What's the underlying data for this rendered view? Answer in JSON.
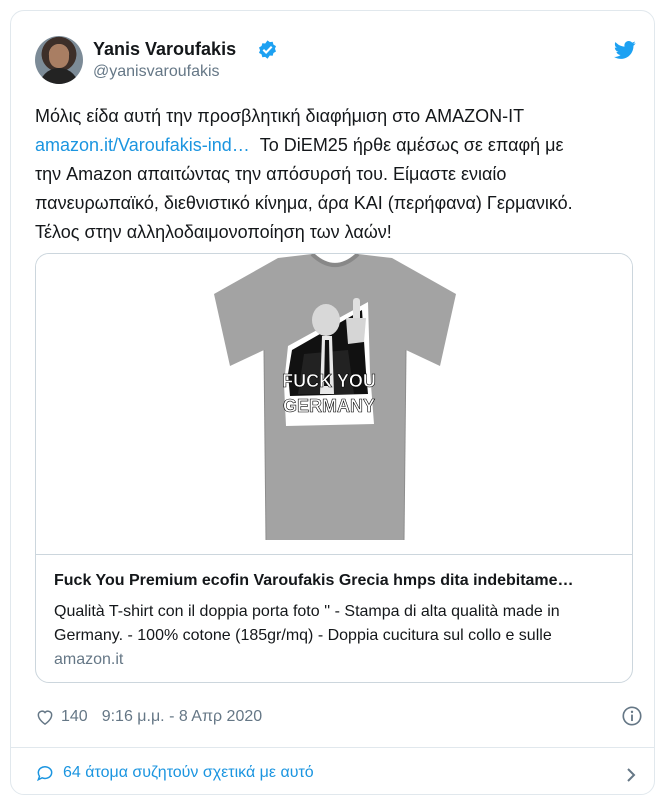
{
  "tweet": {
    "author": {
      "name": "Yanis Varoufakis",
      "handle": "@yanisvaroufakis",
      "verified": true
    },
    "text_lines": [
      "Μόλις είδα αυτή την προσβλητική διαφήμιση στο AMAZON-IT",
      "Το DiEM25 ήρθε αμέσως σε επαφή με",
      "την Amazon απαιτώντας την απόσυρσή του. Είμαστε ενιαίο",
      "πανευρωπαϊκό, διεθνιστικό κίνημα, άρα ΚΑΙ (περήφανα) Γερμανικό.",
      "Τέλος στην αλληλοδαιμονοποίηση των λαών!"
    ],
    "link_text": "amazon.it/Varoufakis-ind…",
    "preview": {
      "shirt_text_line1": "FUCK YOU",
      "shirt_text_line2": "GERMANY",
      "title": "Fuck You Premium ecofin Varoufakis Grecia hmps dita indebitame…",
      "description": "Qualità T-shirt con il doppia porta foto '' - Stampa di alta qualità made in Germany. - 100% cotone (185gr/mq) - Doppia cucitura sul collo e sulle",
      "domain": "amazon.it"
    },
    "likes": "140",
    "timestamp": "9:16 μ.μ. - 8 Απρ 2020",
    "conversation": "64 άτομα συζητούν σχετικά με αυτό"
  },
  "colors": {
    "accent": "#1b95e0",
    "text": "#14171a",
    "muted": "#657786",
    "border": "#e1e8ed"
  },
  "icons": [
    "verified-icon",
    "twitter-bird-icon",
    "heart-icon",
    "info-icon",
    "reply-bubble-icon",
    "chevron-right-icon"
  ]
}
